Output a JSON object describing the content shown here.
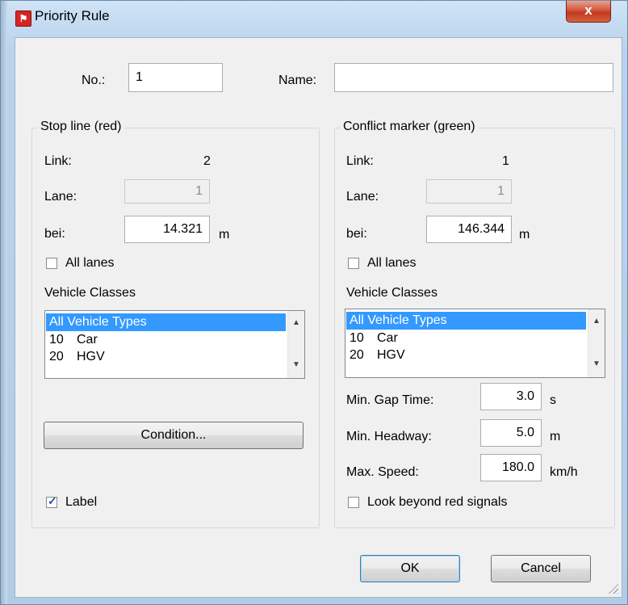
{
  "window": {
    "title": "Priority Rule",
    "close_label": "x"
  },
  "header": {
    "no_label": "No.:",
    "no_value": "1",
    "name_label": "Name:",
    "name_value": ""
  },
  "stop_line": {
    "title": "Stop line (red)",
    "link_label": "Link:",
    "link_value": "2",
    "lane_label": "Lane:",
    "lane_value": "1",
    "at_label": "bei:",
    "at_value": "14.321",
    "at_unit": "m",
    "all_lanes_label": "All lanes",
    "all_lanes_checked": false,
    "vehicle_classes_label": "Vehicle Classes",
    "vehicle_classes": [
      {
        "num": "",
        "name": "All Vehicle Types",
        "selected": true
      },
      {
        "num": "10",
        "name": "Car",
        "selected": false
      },
      {
        "num": "20",
        "name": "HGV",
        "selected": false
      }
    ],
    "condition_button": "Condition...",
    "label_checkbox": "Label",
    "label_checked": true
  },
  "conflict_marker": {
    "title": "Conflict marker (green)",
    "link_label": "Link:",
    "link_value": "1",
    "lane_label": "Lane:",
    "lane_value": "1",
    "at_label": "bei:",
    "at_value": "146.344",
    "at_unit": "m",
    "all_lanes_label": "All lanes",
    "all_lanes_checked": false,
    "vehicle_classes_label": "Vehicle Classes",
    "vehicle_classes": [
      {
        "num": "",
        "name": "All Vehicle Types",
        "selected": true
      },
      {
        "num": "10",
        "name": "Car",
        "selected": false
      },
      {
        "num": "20",
        "name": "HGV",
        "selected": false
      }
    ],
    "min_gap_time_label": "Min. Gap Time:",
    "min_gap_time_value": "3.0",
    "min_gap_time_unit": "s",
    "min_headway_label": "Min. Headway:",
    "min_headway_value": "5.0",
    "min_headway_unit": "m",
    "max_speed_label": "Max. Speed:",
    "max_speed_value": "180.0",
    "max_speed_unit": "km/h",
    "look_beyond_label": "Look beyond red signals",
    "look_beyond_checked": false
  },
  "footer": {
    "ok_label": "OK",
    "cancel_label": "Cancel"
  },
  "icons": {
    "app": "priority-rule-app-icon",
    "close": "close-icon",
    "up": "arrow-up-icon",
    "down": "arrow-down-icon",
    "grip": "resize-grip-icon"
  },
  "colors": {
    "selection": "#3399ff",
    "close_button": "#c74a31",
    "checkmark": "#1f4fb5"
  }
}
